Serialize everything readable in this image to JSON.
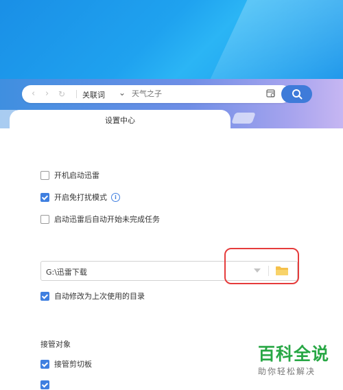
{
  "toolbar": {
    "back_icon": "chevron-left",
    "forward_icon": "chevron-right",
    "refresh_icon": "refresh",
    "address_label": "关联词",
    "address_caret": "⌄",
    "search_placeholder": "天气之子"
  },
  "tab": {
    "label": "设置中心"
  },
  "settings": {
    "startup": {
      "label": "开机启动迅雷",
      "checked": false
    },
    "do_not_disturb": {
      "label": "开启免打扰模式",
      "checked": true
    },
    "auto_resume": {
      "label": "启动迅雷后自动开始未完成任务",
      "checked": false
    },
    "download_dir": {
      "value": "G:\\迅雷下载"
    },
    "auto_last_dir": {
      "label": "自动修改为上次使用的目录",
      "checked": true
    },
    "takeover_section": {
      "title": "接管对象"
    },
    "clipboard": {
      "label": "接管剪切板",
      "checked": true
    }
  },
  "watermark": {
    "title": "百科全说",
    "subtitle": "助你轻松解决"
  },
  "colors": {
    "accent": "#3f7fe0",
    "highlight": "#e53b3b",
    "watermark_green": "#28a745"
  }
}
